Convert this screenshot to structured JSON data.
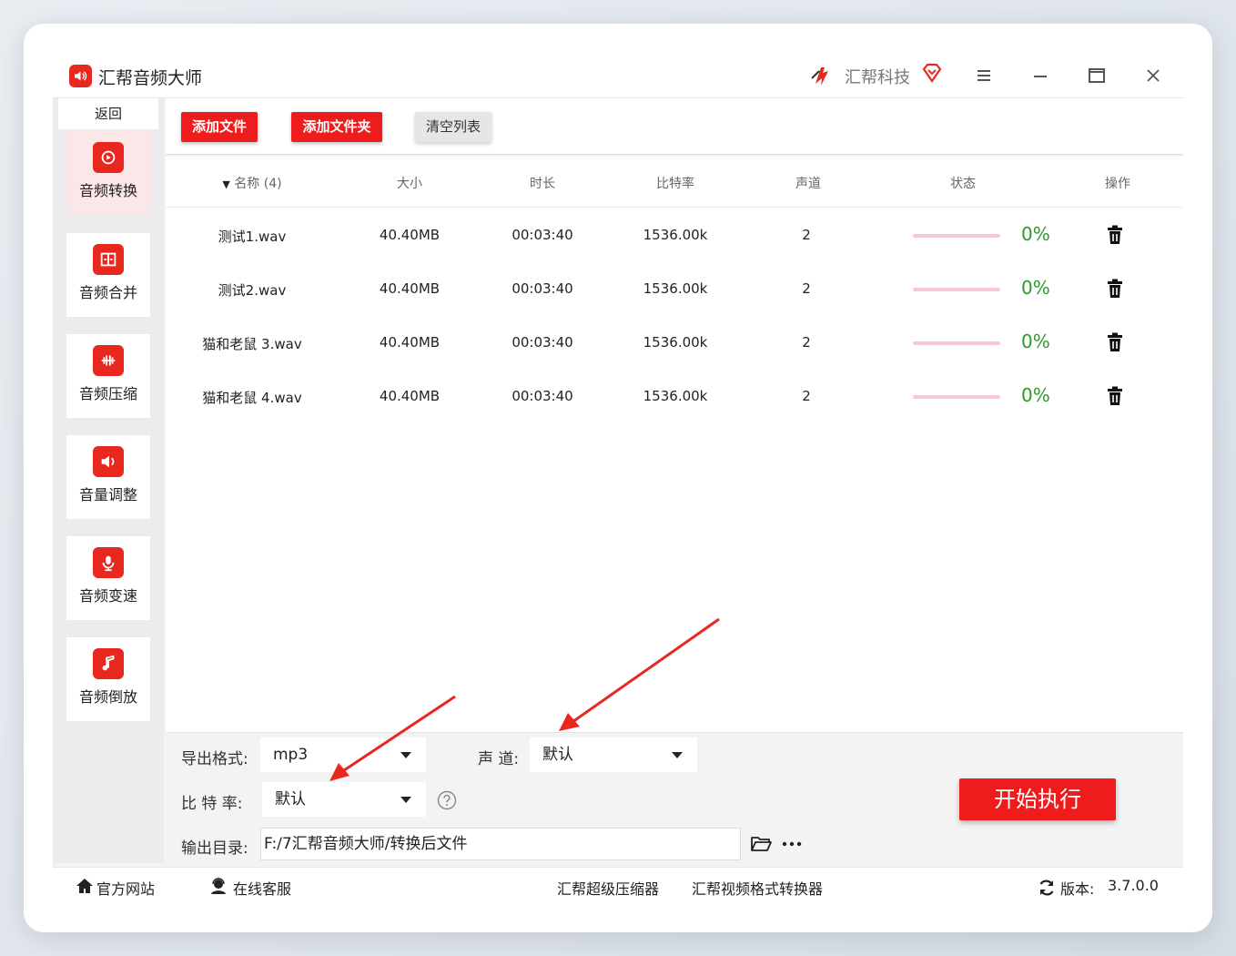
{
  "app": {
    "title": "汇帮音频大师",
    "brand_name": "汇帮科技"
  },
  "sidebar": {
    "back_label": "返回",
    "items": [
      {
        "label": "音频转换",
        "icon": "audio-convert-icon"
      },
      {
        "label": "音频合并",
        "icon": "audio-merge-icon"
      },
      {
        "label": "音频压缩",
        "icon": "audio-compress-icon"
      },
      {
        "label": "音量调整",
        "icon": "volume-icon"
      },
      {
        "label": "音频变速",
        "icon": "microphone-icon"
      },
      {
        "label": "音频倒放",
        "icon": "music-note-icon"
      }
    ]
  },
  "toolbar": {
    "add_file": "添加文件",
    "add_folder": "添加文件夹",
    "clear_list": "清空列表"
  },
  "table": {
    "headers": {
      "name": "名称 (4)",
      "size": "大小",
      "duration": "时长",
      "bitrate": "比特率",
      "channels": "声道",
      "status": "状态",
      "action": "操作"
    },
    "rows": [
      {
        "name": "测试1.wav",
        "size": "40.40MB",
        "duration": "00:03:40",
        "bitrate": "1536.00k",
        "channels": "2",
        "progress_pct": 0,
        "status": "0%"
      },
      {
        "name": "测试2.wav",
        "size": "40.40MB",
        "duration": "00:03:40",
        "bitrate": "1536.00k",
        "channels": "2",
        "progress_pct": 0,
        "status": "0%"
      },
      {
        "name": "猫和老鼠 3.wav",
        "size": "40.40MB",
        "duration": "00:03:40",
        "bitrate": "1536.00k",
        "channels": "2",
        "progress_pct": 0,
        "status": "0%"
      },
      {
        "name": "猫和老鼠 4.wav",
        "size": "40.40MB",
        "duration": "00:03:40",
        "bitrate": "1536.00k",
        "channels": "2",
        "progress_pct": 0,
        "status": "0%"
      }
    ]
  },
  "settings": {
    "format_label": "导出格式:",
    "format_value": "mp3",
    "channel_label": "声 道:",
    "channel_value": "默认",
    "bitrate_label": "比 特 率:",
    "bitrate_value": "默认",
    "output_label": "输出目录:",
    "output_path": "F:/7汇帮音频大师/转换后文件",
    "start_button": "开始执行"
  },
  "footer": {
    "website": "官方网站",
    "support": "在线客服",
    "link1": "汇帮超级压缩器",
    "link2": "汇帮视频格式转换器",
    "version_label": "版本:",
    "version_value": "3.7.0.0"
  },
  "colors": {
    "accent": "#ee1c1c",
    "status_green": "#2b9b2b",
    "progress_track": "#f6c9d2",
    "annotation_arrow": "#e8271f"
  }
}
